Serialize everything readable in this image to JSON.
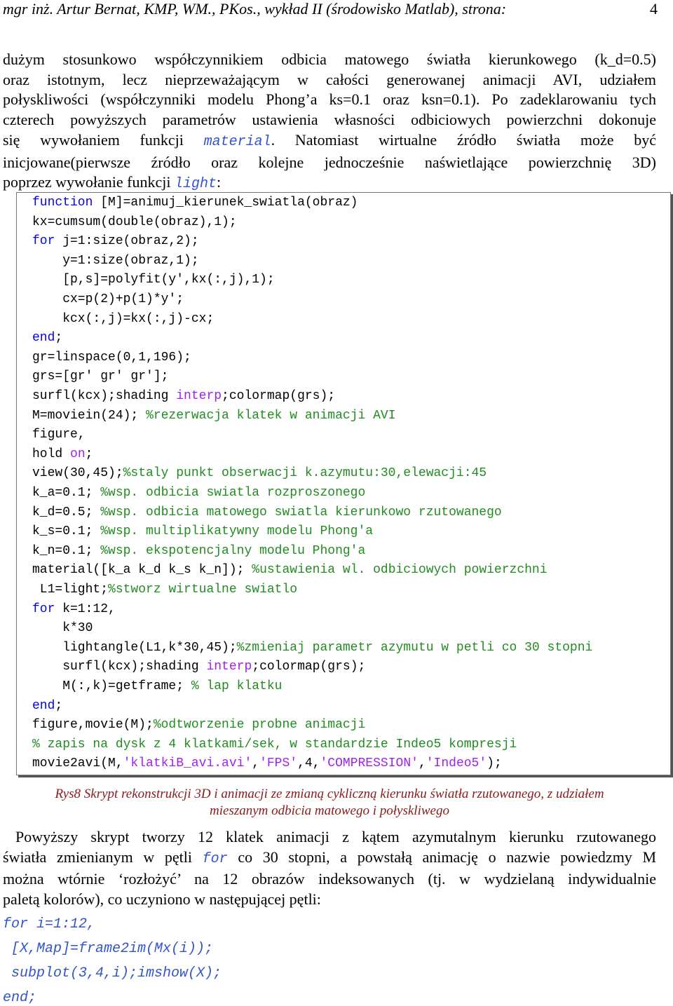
{
  "header": {
    "text": "mgr inż. Artur Bernat, KMP, WM., PKos., wykład II (środowisko Matlab), strona:",
    "page": "4"
  },
  "para1": {
    "l1": "dużym stosunkowo współczynnikiem odbicia matowego światła kierunkowego (k_d=0.5)",
    "l2": "oraz istotnym, lecz nieprzeważającym w całości generowanej animacji AVI, udziałem",
    "l3": "połyskliwości (współczynniki modelu Phong’a ks=0.1 oraz ksn=0.1). Po zadeklarowaniu tych",
    "l4": "czterech powyższych parametrów ustawienia własności odbiciowych powierzchni dokonuje",
    "l5a": "się wywołaniem funkcji",
    "l5code": "material",
    "l5b": ". Natomiast wirtualne źródło światła może być",
    "l6": "inicjowane(pierwsze źródło oraz kolejne jednocześnie naświetlające powierzchnię 3D)",
    "l7a": "poprzez wywołanie funkcji",
    "l7code": "light",
    "l7b": ":"
  },
  "code_colors": {
    "keyword": "#0000ff",
    "string": "#a020f0",
    "comment": "#228b22"
  },
  "code_lines": [
    [
      [
        "function",
        "kw"
      ],
      [
        " [M]=animuj_kierunek_swiatla(obraz)",
        ""
      ]
    ],
    [
      [
        "kx=cumsum(double(obraz),1);",
        ""
      ]
    ],
    [
      [
        "for",
        "kw"
      ],
      [
        " j=1:size(obraz,2);",
        ""
      ]
    ],
    [
      [
        "    y=1:size(obraz,1);",
        ""
      ]
    ],
    [
      [
        "    [p,s]=polyfit(y',kx(:,j),1);",
        ""
      ]
    ],
    [
      [
        "    cx=p(2)+p(1)*y';",
        ""
      ]
    ],
    [
      [
        "    kcx(:,j)=kx(:,j)-cx;",
        ""
      ]
    ],
    [
      [
        "end",
        "kw"
      ],
      [
        ";",
        ""
      ]
    ],
    [
      [
        "gr=linspace(0,1,196);",
        ""
      ]
    ],
    [
      [
        "grs=[gr' gr' gr'];",
        ""
      ]
    ],
    [
      [
        "surfl(kcx);shading ",
        ""
      ],
      [
        "interp",
        "str"
      ],
      [
        ";colormap(grs);",
        ""
      ]
    ],
    [
      [
        "M=moviein(24); ",
        ""
      ],
      [
        "%rezerwacja klatek w animacji AVI",
        "cm"
      ]
    ],
    [
      [
        "figure,",
        ""
      ]
    ],
    [
      [
        "hold ",
        ""
      ],
      [
        "on",
        "str"
      ],
      [
        ";",
        ""
      ]
    ],
    [
      [
        "view(30,45);",
        ""
      ],
      [
        "%staly punkt obserwacji k.azymutu:30,elewacji:45",
        "cm"
      ]
    ],
    [
      [
        "k_a=0.1; ",
        ""
      ],
      [
        "%wsp. odbicia swiatla rozproszonego",
        "cm"
      ]
    ],
    [
      [
        "k_d=0.5; ",
        ""
      ],
      [
        "%wsp. odbicia matowego swiatla kierunkowo rzutowanego",
        "cm"
      ]
    ],
    [
      [
        "k_s=0.1; ",
        ""
      ],
      [
        "%wsp. multiplikatywny modelu Phong'a",
        "cm"
      ]
    ],
    [
      [
        "k_n=0.1; ",
        ""
      ],
      [
        "%wsp. ekspotencjalny modelu Phong'a",
        "cm"
      ]
    ],
    [
      [
        "material([k_a k_d k_s k_n]); ",
        ""
      ],
      [
        "%ustawienia wl. odbiciowych powierzchni",
        "cm"
      ]
    ],
    [
      [
        " L1=light;",
        ""
      ],
      [
        "%stworz wirtualne swiatlo",
        "cm"
      ]
    ],
    [
      [
        "for",
        "kw"
      ],
      [
        " k=1:12,",
        ""
      ]
    ],
    [
      [
        "    k*30",
        ""
      ]
    ],
    [
      [
        "    lightangle(L1,k*30,45);",
        ""
      ],
      [
        "%zmieniaj parametr azymutu w petli co 30 stopni",
        "cm"
      ]
    ],
    [
      [
        "    surfl(kcx);shading ",
        ""
      ],
      [
        "interp",
        "str"
      ],
      [
        ";colormap(grs);",
        ""
      ]
    ],
    [
      [
        "    M(:,k)=getframe; ",
        ""
      ],
      [
        "% lap klatku",
        "cm"
      ]
    ],
    [
      [
        "end",
        "kw"
      ],
      [
        ";",
        ""
      ]
    ],
    [
      [
        "figure,movie(M);",
        ""
      ],
      [
        "%odtworzenie probne animacji",
        "cm"
      ]
    ],
    [
      [
        "% zapis na dysk z 4 klatkami/sek, w standardzie Indeo5 kompresji",
        "cm"
      ]
    ],
    [
      [
        "movie2avi(M,",
        ""
      ],
      [
        "'klatkiB_avi.avi'",
        "str"
      ],
      [
        ",",
        ""
      ],
      [
        "'FPS'",
        "str"
      ],
      [
        ",4,",
        ""
      ],
      [
        "'COMPRESSION'",
        "str"
      ],
      [
        ",",
        ""
      ],
      [
        "'Indeo5'",
        "str"
      ],
      [
        ");",
        ""
      ]
    ]
  ],
  "caption": {
    "l1": "Rys8 Skrypt rekonstrukcji 3D i animacji ze zmianą cykliczną kierunku światła rzutowanego, z udziałem",
    "l2": "mieszanym odbicia matowego i połyskliwego"
  },
  "para2": {
    "l1": "Powyższy skrypt tworzy 12 klatek animacji z kątem azymutalnym kierunku rzutowanego",
    "l2a": "światła zmienianym w pętli",
    "l2code": "for",
    "l2b": "co 30 stopni, a powstałą animację o nazwie powiedzmy M",
    "l3": "można wtórnie ‘rozłożyć’ na 12 obrazów indeksowanych (tj. w wydzielaną indywidualnie",
    "l4": "paletą kolorów), co uczyniono w następującej pętli:"
  },
  "tail_code": [
    "for i=1:12,",
    " [X,Map]=frame2im(Mx(i));",
    " subplot(3,4,i);imshow(X);",
    "end;"
  ]
}
